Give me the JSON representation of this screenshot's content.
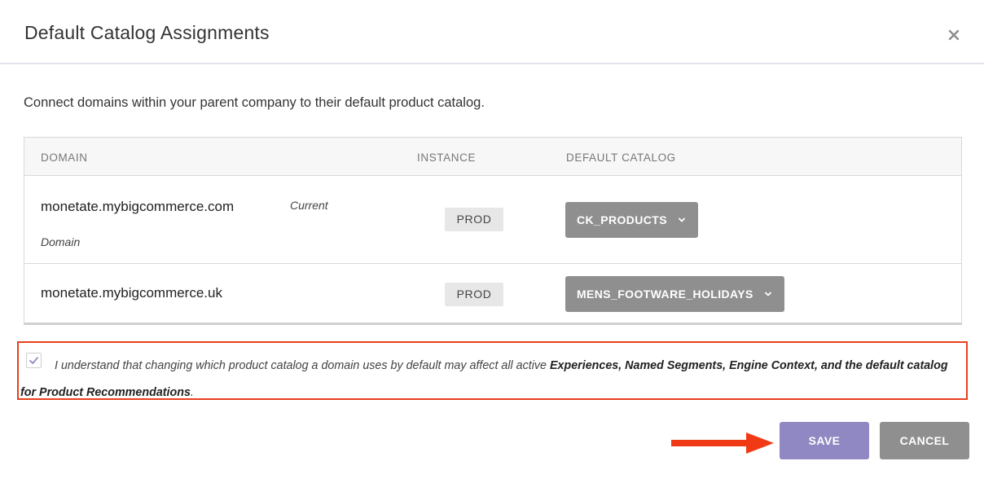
{
  "dialog": {
    "title": "Default Catalog Assignments",
    "description": "Connect domains within your parent company to their default product catalog."
  },
  "table": {
    "headers": {
      "domain": "DOMAIN",
      "instance": "INSTANCE",
      "default_catalog": "DEFAULT CATALOG"
    },
    "rows": [
      {
        "domain": "monetate.mybigcommerce.com",
        "current_label_1": "Current",
        "current_label_2": "Domain",
        "instance": "PROD",
        "catalog": "CK_PRODUCTS"
      },
      {
        "domain": "monetate.mybigcommerce.uk",
        "instance": "PROD",
        "catalog": "MENS_FOOTWARE_HOLIDAYS"
      }
    ]
  },
  "acknowledgement": {
    "checked": true,
    "text_start": "I understand that changing which product catalog a domain uses by default may affect all active ",
    "text_bold_1": "Experiences, Named Segments, Engine Context,",
    "text_bold_2": "and the default catalog for Product Recommendations",
    "text_end": "."
  },
  "actions": {
    "save_label": "SAVE",
    "cancel_label": "CANCEL"
  },
  "colors": {
    "accent_purple": "#9088c2",
    "button_gray": "#8f8f8f",
    "highlight_red": "#e8401c",
    "arrow_red": "#f03a16"
  },
  "icons": {
    "close": "close-icon",
    "chevron": "chevron-down-icon",
    "check": "checkmark-icon",
    "arrow": "arrow-right-icon"
  }
}
